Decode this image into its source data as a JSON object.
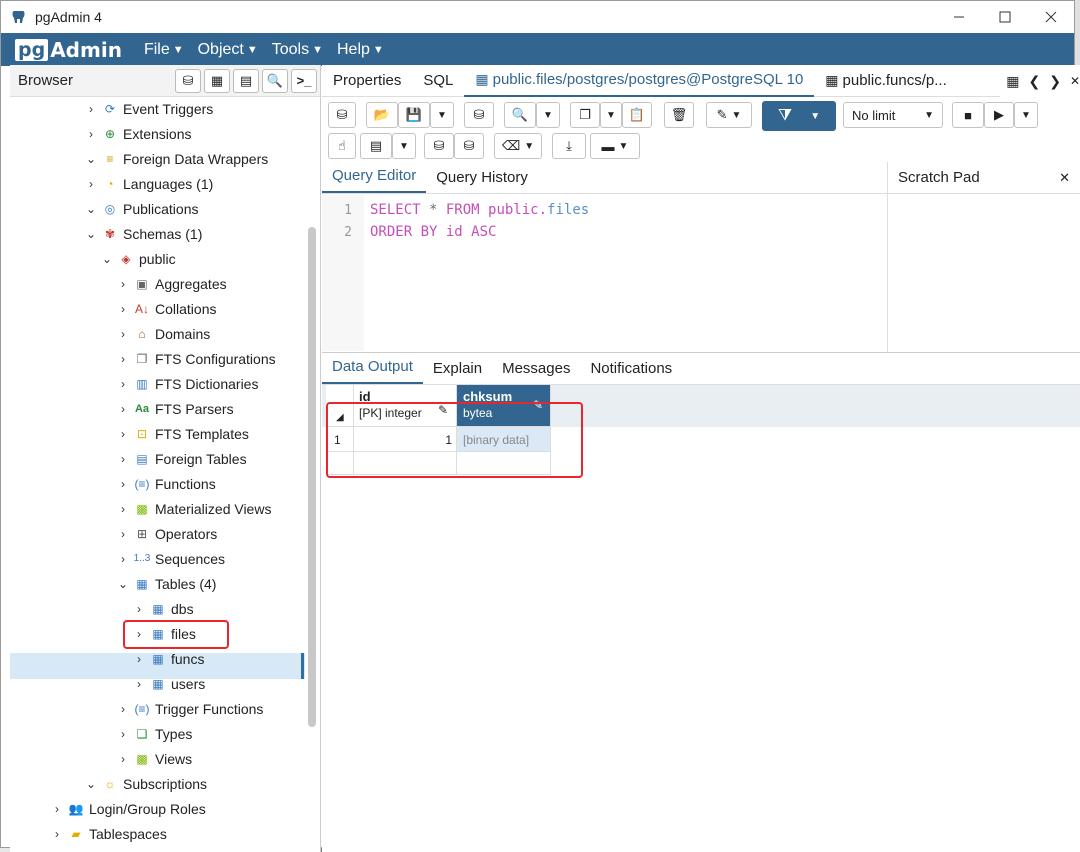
{
  "window": {
    "title": "pgAdmin 4"
  },
  "menu": {
    "logo_pg": "pg",
    "logo_admin": "Admin",
    "items": [
      "File",
      "Object",
      "Tools",
      "Help"
    ]
  },
  "browser": {
    "label": "Browser",
    "tree": [
      "Event Triggers",
      "Extensions",
      "Foreign Data Wrappers",
      "Languages (1)",
      "Publications",
      "Schemas (1)",
      "public",
      "Aggregates",
      "Collations",
      "Domains",
      "FTS Configurations",
      "FTS Dictionaries",
      "FTS Parsers",
      "FTS Templates",
      "Foreign Tables",
      "Functions",
      "Materialized Views",
      "Operators",
      "Sequences",
      "Tables (4)",
      "dbs",
      "files",
      "funcs",
      "users",
      "Trigger Functions",
      "Types",
      "Views",
      "Subscriptions",
      "Login/Group Roles",
      "Tablespaces"
    ]
  },
  "tabs": {
    "properties": "Properties",
    "sql": "SQL",
    "active": "public.files/postgres/postgres@PostgreSQL 10",
    "second": "public.funcs/p..."
  },
  "toolbar": {
    "limit": "No limit"
  },
  "query_editor": {
    "tab_editor": "Query Editor",
    "tab_history": "Query History",
    "lines": [
      {
        "num": "1",
        "kw1": "SELECT",
        "star": " * ",
        "kw2": "FROM",
        "schema": " public.",
        "table": "files"
      },
      {
        "num": "2",
        "kw1": "ORDER BY",
        "col": " id",
        "kw2": " ASC"
      }
    ]
  },
  "scratch": {
    "title": "Scratch Pad",
    "close": "✕"
  },
  "output": {
    "tabs": [
      "Data Output",
      "Explain",
      "Messages",
      "Notifications"
    ],
    "columns": [
      {
        "name": "id",
        "type": "[PK] integer"
      },
      {
        "name": "chksum",
        "type": "bytea"
      }
    ],
    "rows": [
      {
        "rownum": "1",
        "id": "1",
        "chksum": "[binary data]"
      }
    ]
  }
}
